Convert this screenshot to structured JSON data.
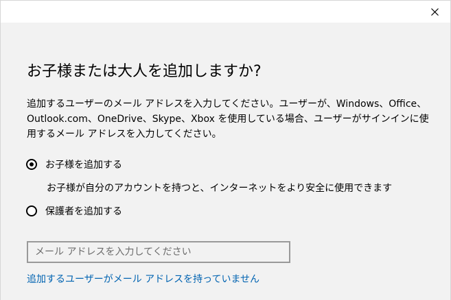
{
  "dialog": {
    "heading": "お子様または大人を追加しますか?",
    "description": "追加するユーザーのメール アドレスを入力してください。ユーザーが、Windows、Office、Outlook.com、OneDrive、Skype、Xbox を使用している場合、ユーザーがサインインに使用するメール アドレスを入力してください。",
    "options": [
      {
        "label": "お子様を追加する",
        "checked": true,
        "sub": "お子様が自分のアカウントを持つと、インターネットをより安全に使用できます"
      },
      {
        "label": "保護者を追加する",
        "checked": false
      }
    ],
    "email_placeholder": "メール アドレスを入力してください",
    "email_value": "",
    "no_email_link": "追加するユーザーがメール アドレスを持っていません"
  },
  "icons": {
    "close": "close-icon"
  },
  "colors": {
    "background": "#f2f2f2",
    "titlebar": "#ffffff",
    "link": "#0063b1",
    "input_border": "#999999"
  }
}
